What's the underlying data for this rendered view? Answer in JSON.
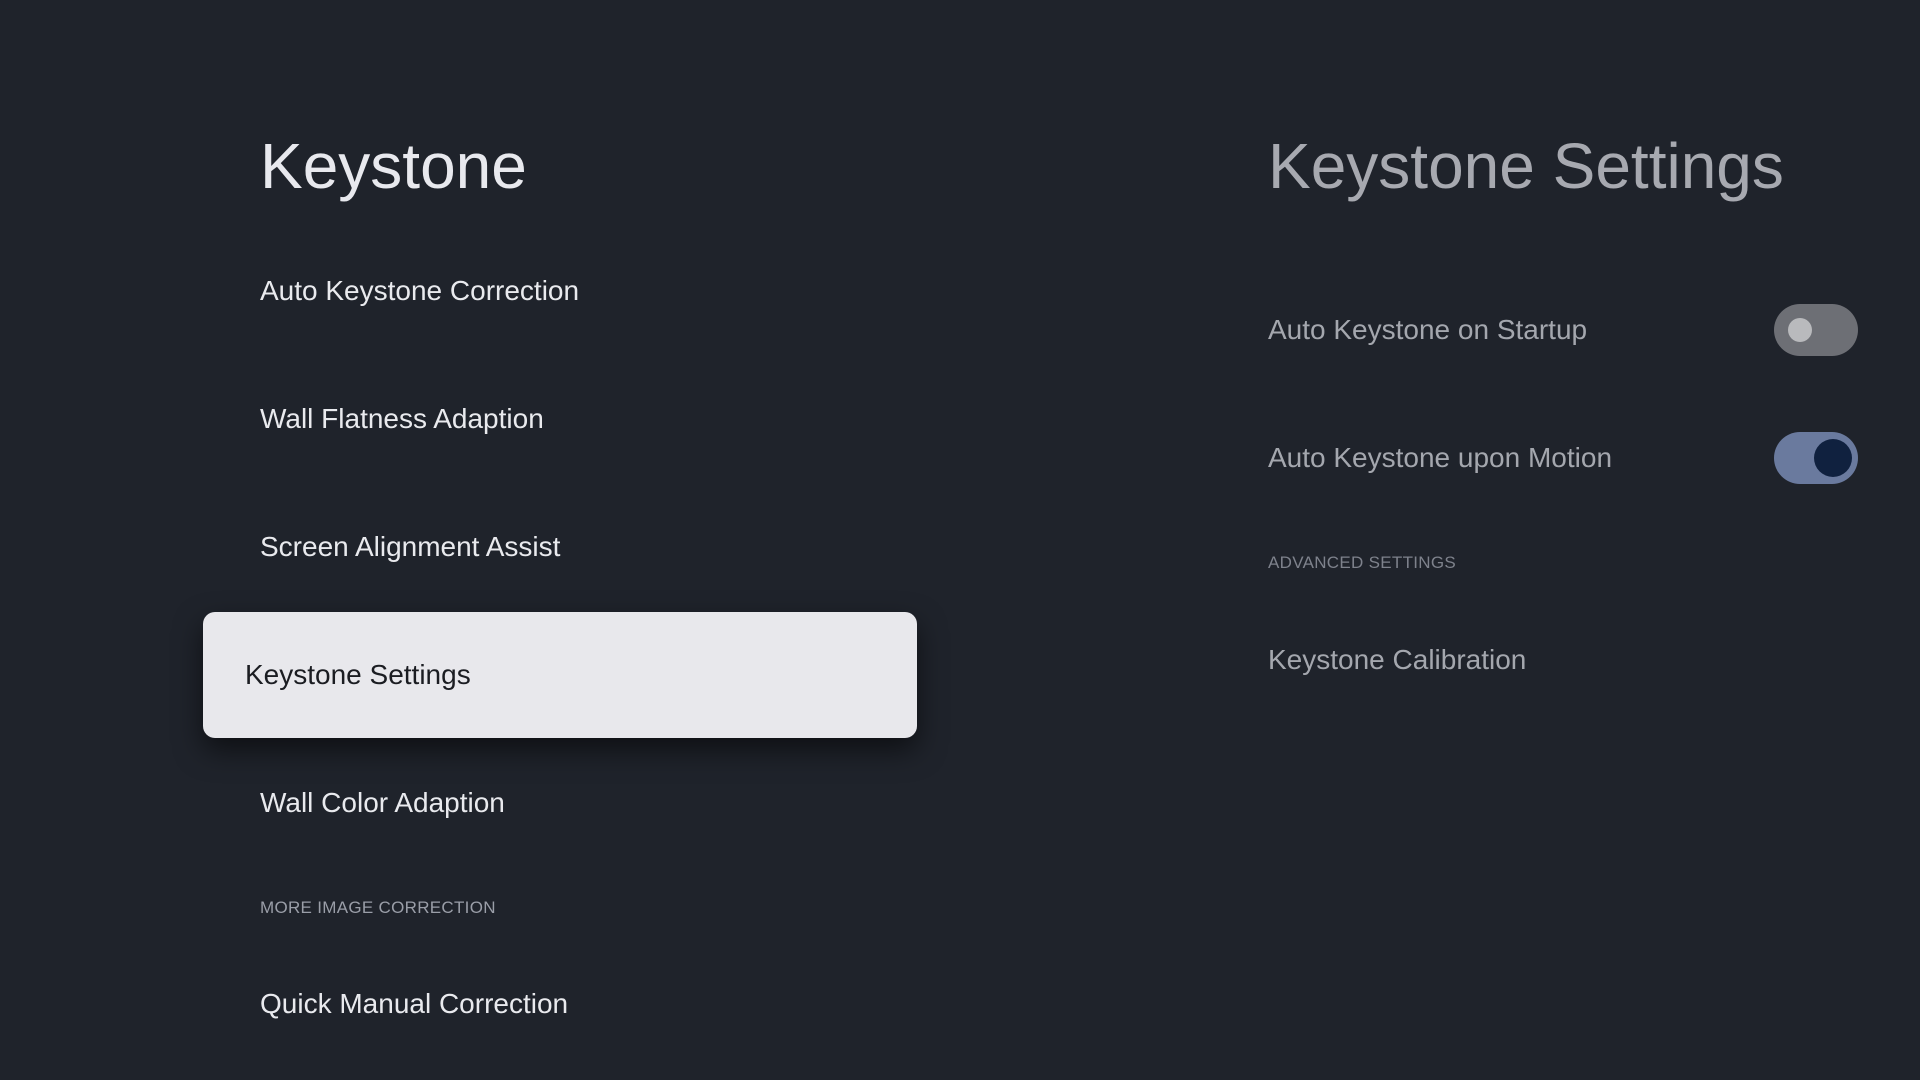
{
  "left_panel": {
    "title": "Keystone",
    "items": [
      {
        "label": "Auto Keystone Correction",
        "selected": false
      },
      {
        "label": "Wall Flatness Adaption",
        "selected": false
      },
      {
        "label": "Screen Alignment Assist",
        "selected": false
      },
      {
        "label": "Keystone Settings",
        "selected": true
      },
      {
        "label": "Wall Color Adaption",
        "selected": false
      }
    ],
    "section_header": "MORE IMAGE CORRECTION",
    "extra_items": [
      {
        "label": "Quick Manual Correction"
      }
    ]
  },
  "right_panel": {
    "title": "Keystone Settings",
    "toggles": [
      {
        "label": "Auto Keystone on Startup",
        "state": "off"
      },
      {
        "label": "Auto Keystone upon Motion",
        "state": "on"
      }
    ],
    "section_header": "ADVANCED SETTINGS",
    "links": [
      {
        "label": "Keystone Calibration"
      }
    ]
  },
  "colors": {
    "background": "#1f232b",
    "selected_item_bg": "#e8e8ec",
    "toggle_on_track": "#6a7a9e",
    "toggle_on_knob": "#10213f",
    "toggle_off_track": "#6d6f75"
  }
}
